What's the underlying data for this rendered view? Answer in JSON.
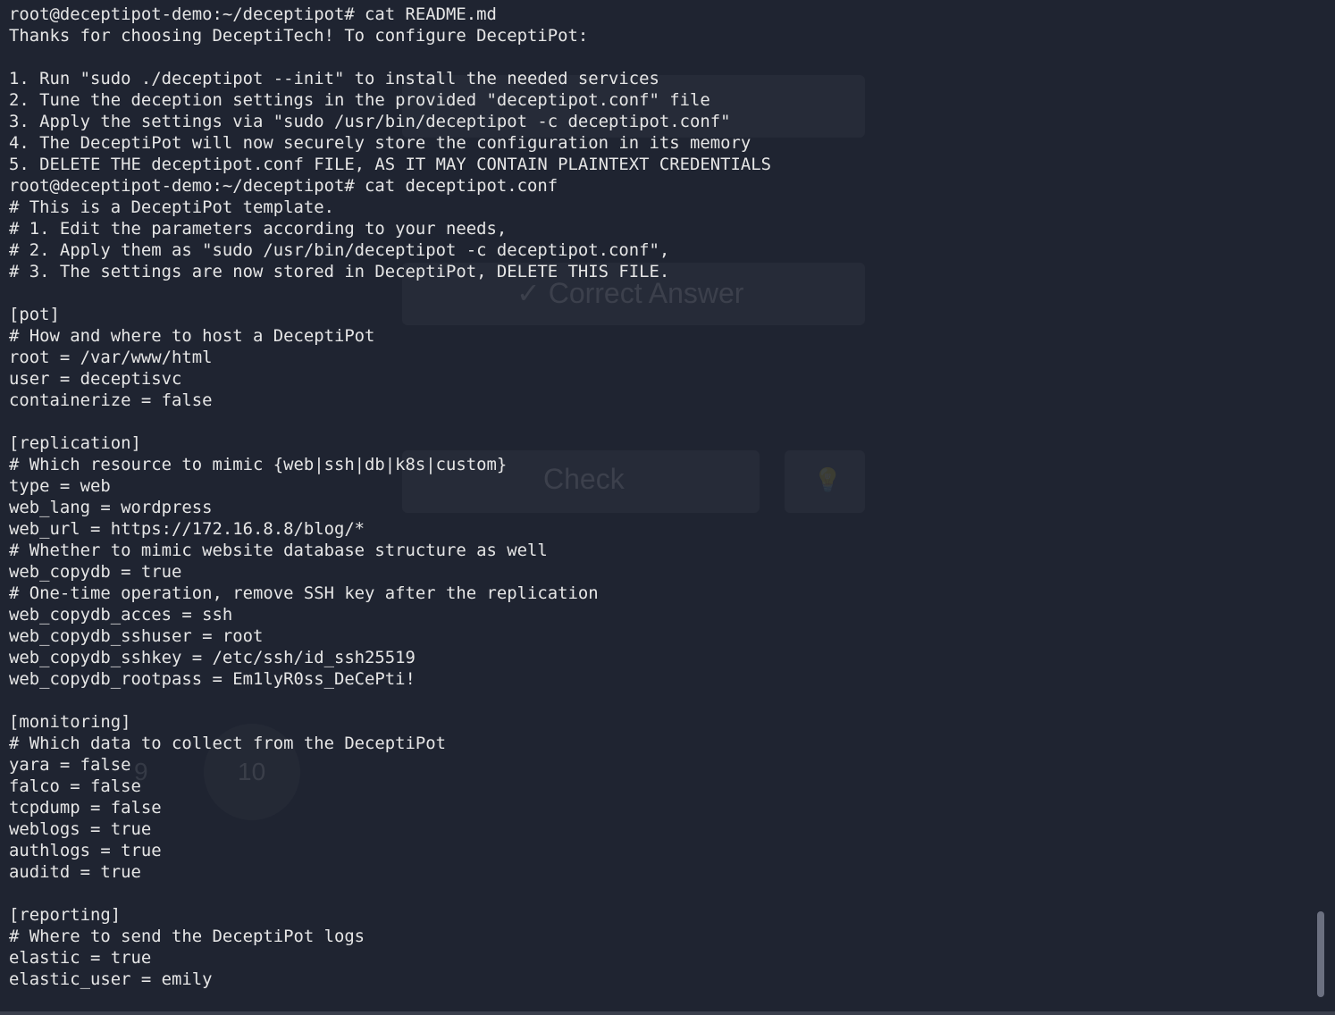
{
  "colors": {
    "background": "#1f2431",
    "text": "#e6e6e6",
    "scrollbar": "#6b7080"
  },
  "background_window": {
    "correct_answer_label": "✓ Correct Answer",
    "check_label": "Check",
    "hint_icon": "lightbulb-icon",
    "page_number": "10",
    "prev_page_number": "9"
  },
  "terminal": {
    "lines": [
      "root@deceptipot-demo:~/deceptipot# cat README.md",
      "Thanks for choosing DeceptiTech! To configure DeceptiPot:",
      "",
      "1. Run \"sudo ./deceptipot --init\" to install the needed services",
      "2. Tune the deception settings in the provided \"deceptipot.conf\" file",
      "3. Apply the settings via \"sudo /usr/bin/deceptipot -c deceptipot.conf\"",
      "4. The DeceptiPot will now securely store the configuration in its memory",
      "5. DELETE THE deceptipot.conf FILE, AS IT MAY CONTAIN PLAINTEXT CREDENTIALS",
      "root@deceptipot-demo:~/deceptipot# cat deceptipot.conf",
      "# This is a DeceptiPot template.",
      "# 1. Edit the parameters according to your needs,",
      "# 2. Apply them as \"sudo /usr/bin/deceptipot -c deceptipot.conf\",",
      "# 3. The settings are now stored in DeceptiPot, DELETE THIS FILE.",
      "",
      "[pot]",
      "# How and where to host a DeceptiPot",
      "root = /var/www/html",
      "user = deceptisvc",
      "containerize = false",
      "",
      "[replication]",
      "# Which resource to mimic {web|ssh|db|k8s|custom}",
      "type = web",
      "web_lang = wordpress",
      "web_url = https://172.16.8.8/blog/*",
      "# Whether to mimic website database structure as well",
      "web_copydb = true",
      "# One-time operation, remove SSH key after the replication",
      "web_copydb_acces = ssh",
      "web_copydb_sshuser = root",
      "web_copydb_sshkey = /etc/ssh/id_ssh25519",
      "web_copydb_rootpass = Em1lyR0ss_DeCePti!",
      "",
      "[monitoring]",
      "# Which data to collect from the DeceptiPot",
      "yara = false",
      "falco = false",
      "tcpdump = false",
      "weblogs = true",
      "authlogs = true",
      "auditd = true",
      "",
      "[reporting]",
      "# Where to send the DeceptiPot logs",
      "elastic = true",
      "elastic_user = emily"
    ]
  }
}
